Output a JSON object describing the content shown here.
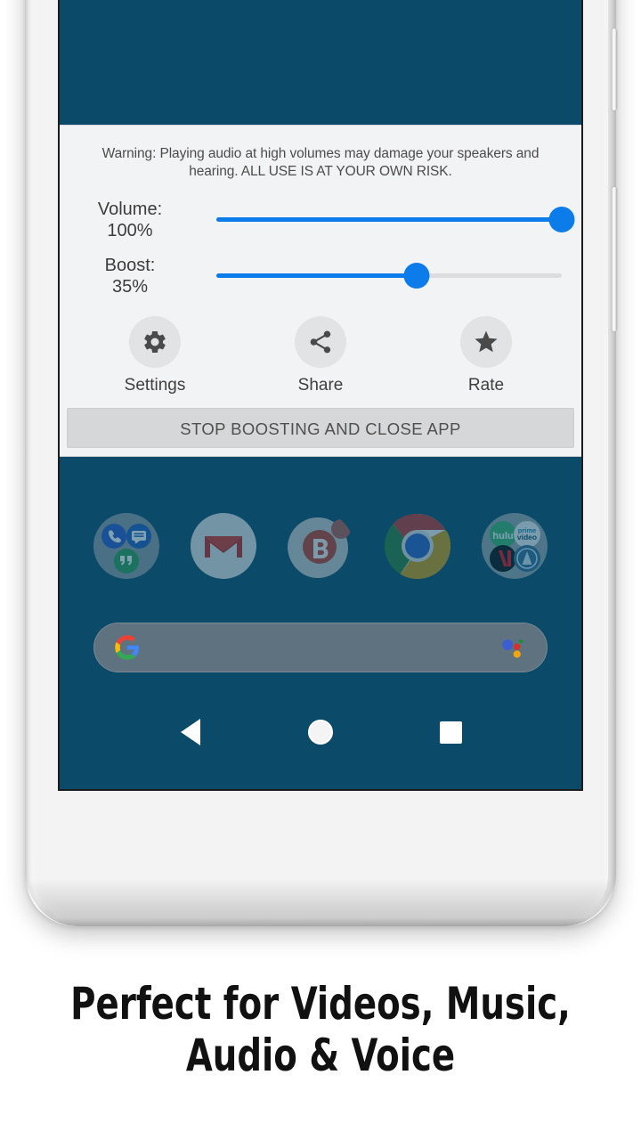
{
  "app": {
    "warning_text": "Warning: Playing audio at high volumes may damage your speakers and hearing. ALL USE IS AT YOUR OWN RISK.",
    "sliders": [
      {
        "name": "volume",
        "label": "Volume:",
        "value_text": "100%",
        "value": 100,
        "fill_percent": 100,
        "thumb_percent": 100
      },
      {
        "name": "boost",
        "label": "Boost:",
        "value_text": "35%",
        "value": 35,
        "fill_percent": 58,
        "thumb_percent": 58
      }
    ],
    "actions": [
      {
        "label": "Settings",
        "icon": "gear-icon"
      },
      {
        "label": "Share",
        "icon": "share-icon"
      },
      {
        "label": "Rate",
        "icon": "star-icon"
      }
    ],
    "stop_button_label": "STOP BOOSTING AND CLOSE APP"
  },
  "homescreen": {
    "dock_icons": [
      {
        "name": "phone-messages-duo-folder-icon"
      },
      {
        "name": "gmail-icon"
      },
      {
        "name": "bose-connect-icon"
      },
      {
        "name": "chrome-icon"
      },
      {
        "name": "streaming-apps-folder-icon"
      }
    ],
    "search_bar": {
      "left_icon": "google-g-icon",
      "right_icon": "google-assistant-icon",
      "placeholder": ""
    },
    "nav_bar": [
      {
        "name": "back-button",
        "icon": "triangle-back-icon"
      },
      {
        "name": "home-button",
        "icon": "circle-home-icon"
      },
      {
        "name": "recents-button",
        "icon": "square-recents-icon"
      }
    ]
  },
  "caption": {
    "line1": "Perfect for Videos, Music,",
    "line2": "Audio & Voice"
  },
  "colors": {
    "screen_background": "#0b4a69",
    "panel_background": "#f2f3f5",
    "slider_accent": "#0d7ceb",
    "slider_track": "#dcdddf",
    "stop_button": "#d6d7d9",
    "caption_text": "#111111"
  }
}
